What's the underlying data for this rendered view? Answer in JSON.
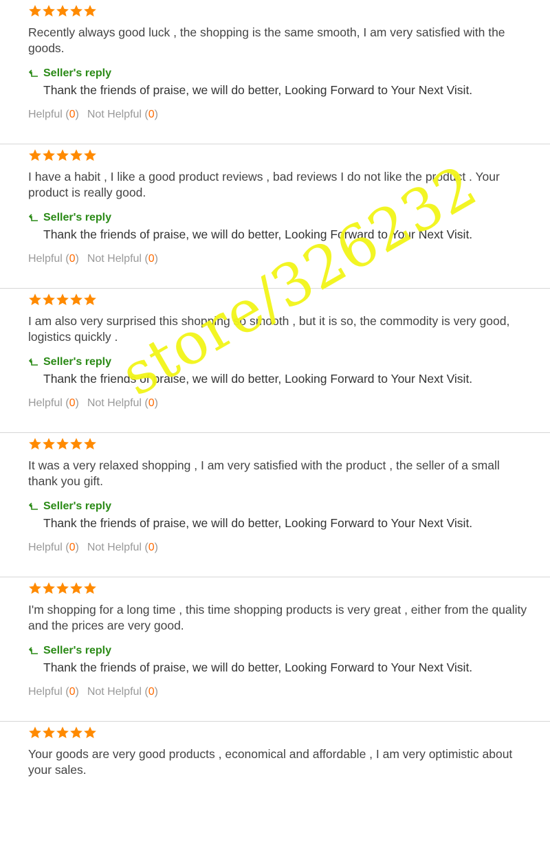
{
  "colors": {
    "star": "#ff8a00",
    "reply_label": "#2a8a16",
    "count": "#ff6a00",
    "muted": "#999999",
    "text": "#444444",
    "divider": "#d6d6d6",
    "watermark": "#f2f519"
  },
  "reviews": [
    {
      "rating": 5,
      "text": "Recently always good luck , the shopping is the same smooth, I am very satisfied with the goods.",
      "reply_label": "Seller's reply",
      "reply_text": "Thank the friends of praise, we will do better, Looking Forward to Your Next Visit.",
      "helpful_label": "Helpful",
      "helpful_count": "0",
      "not_helpful_label": "Not Helpful",
      "not_helpful_count": "0"
    },
    {
      "rating": 5,
      "text": "I have a habit , I like a good product reviews , bad reviews I do not like the product . Your product is really good.",
      "reply_label": "Seller's reply",
      "reply_text": "Thank the friends of praise, we will do better, Looking Forward to Your Next Visit.",
      "helpful_label": "Helpful",
      "helpful_count": "0",
      "not_helpful_label": "Not Helpful",
      "not_helpful_count": "0"
    },
    {
      "rating": 5,
      "text": "I am also very surprised this shopping so smooth , but it is so, the commodity is very good, logistics quickly .",
      "reply_label": "Seller's reply",
      "reply_text": "Thank the friends of praise, we will do better, Looking Forward to Your Next Visit.",
      "helpful_label": "Helpful",
      "helpful_count": "0",
      "not_helpful_label": "Not Helpful",
      "not_helpful_count": "0"
    },
    {
      "rating": 5,
      "text": "It was a very relaxed shopping , I am very satisfied with the product , the seller of a small thank you gift.",
      "reply_label": "Seller's reply",
      "reply_text": "Thank the friends of praise, we will do better, Looking Forward to Your Next Visit.",
      "helpful_label": "Helpful",
      "helpful_count": "0",
      "not_helpful_label": "Not Helpful",
      "not_helpful_count": "0"
    },
    {
      "rating": 5,
      "text": "I'm shopping for a long time , this time shopping products is very great , either from the quality and the prices are very good.",
      "reply_label": "Seller's reply",
      "reply_text": "Thank the friends of praise, we will do better, Looking Forward to Your Next Visit.",
      "helpful_label": "Helpful",
      "helpful_count": "0",
      "not_helpful_label": "Not Helpful",
      "not_helpful_count": "0"
    },
    {
      "rating": 5,
      "text": "Your goods are very good products , economical and affordable , I am very optimistic about your sales."
    }
  ],
  "watermark": {
    "text": "store/326232"
  },
  "icons": {
    "star": "star-icon",
    "reply": "reply-arrow-icon"
  }
}
